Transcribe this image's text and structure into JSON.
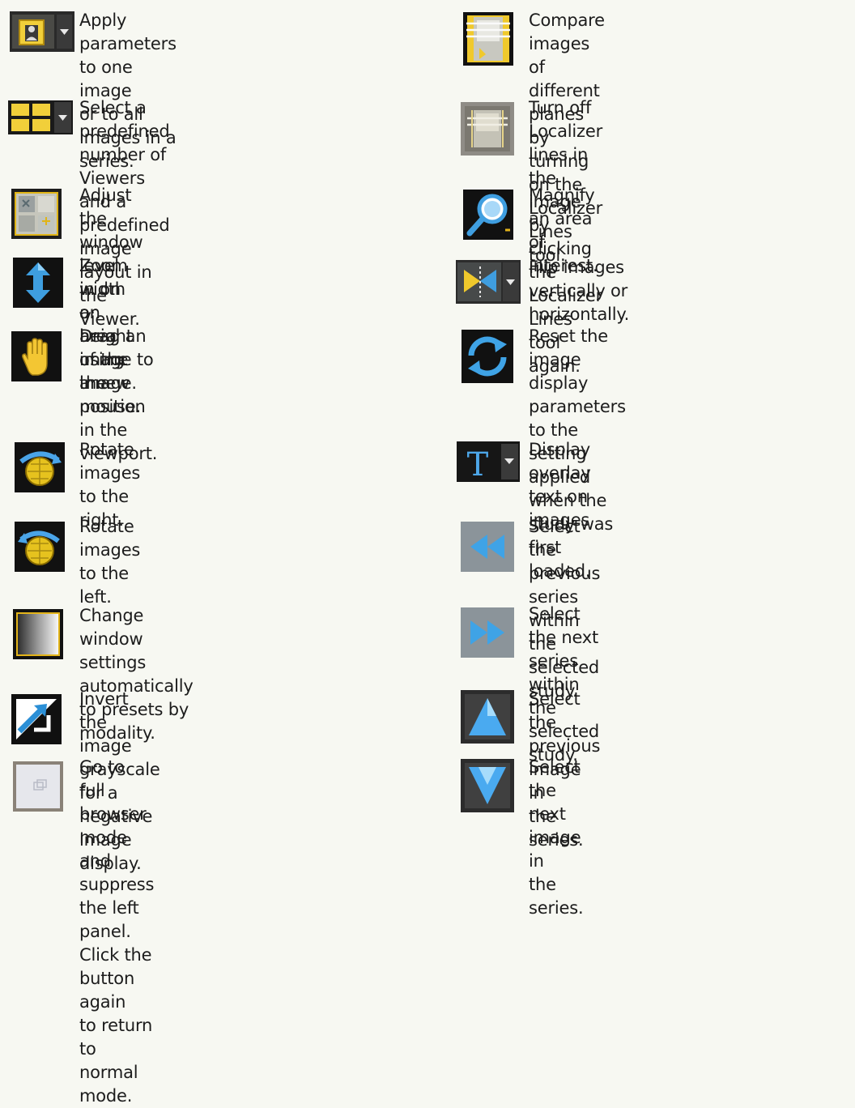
{
  "left_column": [
    {
      "icon": "apply-parameters-icon",
      "text": "Apply parameters to one image\nor to all images in a series."
    },
    {
      "icon": "viewer-layout-icon",
      "text": "Select a predefined number of\nViewers and a predefined image\nlayout in the Viewer."
    },
    {
      "icon": "window-level-icon",
      "text": "Adjust the window level width\nor height using the mouse."
    },
    {
      "icon": "zoom-arrow-icon",
      "text": "Zoom in on an area of the image."
    },
    {
      "icon": "pan-hand-icon",
      "text": "Drag an image to a new position\nin the viewport."
    },
    {
      "icon": "rotate-right-icon",
      "text": "Rotate images to the right."
    },
    {
      "icon": "rotate-left-icon",
      "text": "Rotate images to the left."
    },
    {
      "icon": "window-presets-icon",
      "text": "Change window settings automatically\nto presets by modality."
    },
    {
      "icon": "invert-grayscale-icon",
      "text": "Invert the image grayscale for a\nnegative image display."
    },
    {
      "icon": "full-browser-mode-icon",
      "text": "Go to full browser mode and suppress\nthe left panel. Click the button again\nto return to normal mode."
    }
  ],
  "right_column": [
    {
      "icon": "localizer-lines-on-icon",
      "text": "Compare images of different planes\nby turning on the Localizer Lines\ntool."
    },
    {
      "icon": "localizer-lines-off-icon",
      "text": "Turn off Localizer lines in the image\nby clicking the Localizer Lines tool\nagain."
    },
    {
      "icon": "magnify-icon",
      "text": "Magnify an area of interest."
    },
    {
      "icon": "flip-image-icon",
      "text": "Flip images vertically or\nhorizontally."
    },
    {
      "icon": "reset-display-icon",
      "text": "Reset the image display parameters\nto the setting applied when the\nstudy was first loaded."
    },
    {
      "icon": "overlay-text-icon",
      "text": "Display overlay text on images"
    },
    {
      "icon": "previous-series-icon",
      "text": "Select the previous series within\nthe selected study."
    },
    {
      "icon": "next-series-icon",
      "text": "Select the next series within the\nselected study."
    },
    {
      "icon": "previous-image-icon",
      "text": "Select the previous image in\nthe series."
    },
    {
      "icon": "next-image-icon",
      "text": "Select the next image in\nthe series."
    }
  ],
  "colors": {
    "background": "#f7f8f2",
    "text": "#1c1c1c",
    "icon_dark": "#141414",
    "icon_gold": "#e8b818",
    "icon_blue": "#3a9fe0"
  }
}
